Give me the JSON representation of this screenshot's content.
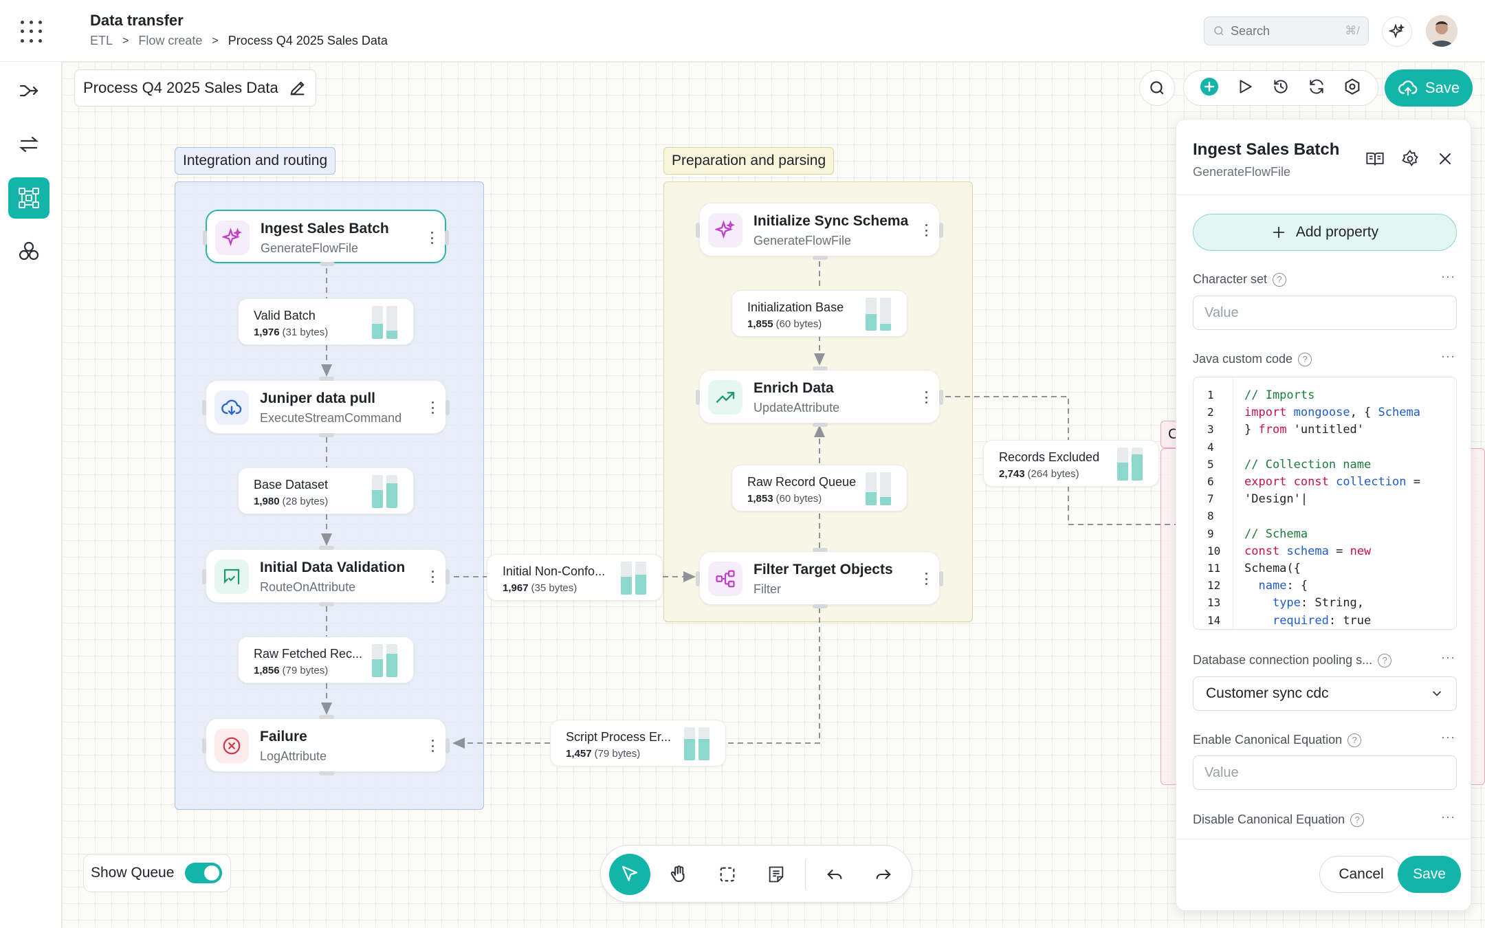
{
  "header": {
    "title": "Data transfer",
    "breadcrumb": [
      "ETL",
      "Flow create",
      "Process Q4 2025 Sales Data"
    ],
    "search_placeholder": "Search",
    "search_shortcut": "⌘/"
  },
  "sidebar": {
    "items": [
      {
        "icon": "route-merge-icon",
        "active": false
      },
      {
        "icon": "transfer-arrows-icon",
        "active": false
      },
      {
        "icon": "flow-builder-icon",
        "active": true
      },
      {
        "icon": "cluster-icon",
        "active": false
      }
    ]
  },
  "canvas": {
    "flow_title": "Process Q4 2025 Sales Data",
    "save_label": "Save",
    "groups": {
      "integration": "Integration and routing",
      "preparation": "Preparation and parsing",
      "third_partial": "C"
    },
    "nodes": {
      "ingest": {
        "title": "Ingest Sales Batch",
        "type": "GenerateFlowFile"
      },
      "juniper": {
        "title": "Juniper data pull",
        "type": "ExecuteStreamCommand"
      },
      "validation": {
        "title": "Initial Data Validation",
        "type": "RouteOnAttribute"
      },
      "failure": {
        "title": "Failure",
        "type": "LogAttribute"
      },
      "init_schema": {
        "title": "Initialize Sync Schema",
        "type": "GenerateFlowFile"
      },
      "enrich": {
        "title": "Enrich Data",
        "type": "UpdateAttribute"
      },
      "filter": {
        "title": "Filter Target Objects",
        "type": "Filter"
      }
    },
    "queues": {
      "valid_batch": {
        "title": "Valid Batch",
        "count": "1,976",
        "size": "(31 bytes)",
        "fill": [
          0.45,
          0.25
        ]
      },
      "base_dataset": {
        "title": "Base Dataset",
        "count": "1,980",
        "size": "(28 bytes)",
        "fill": [
          0.55,
          0.75
        ]
      },
      "raw_fetched": {
        "title": "Raw Fetched Rec...",
        "count": "1,856",
        "size": "(79 bytes)",
        "fill": [
          0.55,
          0.7
        ]
      },
      "initial_nonconf": {
        "title": "Initial Non-Confo...",
        "count": "1,967",
        "size": "(35 bytes)",
        "fill": [
          0.55,
          0.6
        ]
      },
      "init_base": {
        "title": "Initialization Base",
        "count": "1,855",
        "size": "(60 bytes)",
        "fill": [
          0.5,
          0.2
        ]
      },
      "raw_record": {
        "title": "Raw Record Queue",
        "count": "1,853",
        "size": "(60 bytes)",
        "fill": [
          0.4,
          0.25
        ]
      },
      "script_err": {
        "title": "Script Process Er...",
        "count": "1,457",
        "size": "(79 bytes)",
        "fill": [
          0.65,
          0.65
        ]
      },
      "records_excluded": {
        "title": "Records Excluded",
        "count": "2,743",
        "size": "(264 bytes)",
        "fill": [
          0.55,
          0.8
        ]
      }
    }
  },
  "panel": {
    "title": "Ingest Sales Batch",
    "subtitle": "GenerateFlowFile",
    "add_property": "Add property",
    "charset": {
      "label": "Character set",
      "placeholder": "Value"
    },
    "java": {
      "label": "Java custom code",
      "lines": [
        {
          "n": "1",
          "t": "// Imports"
        },
        {
          "n": "2",
          "t": "import mongoose, { Schema"
        },
        {
          "n": "3",
          "t": "} from 'untitled'"
        },
        {
          "n": "4",
          "t": ""
        },
        {
          "n": "5",
          "t": "// Collection name"
        },
        {
          "n": "6",
          "t": "export const collection ="
        },
        {
          "n": "7",
          "t": "'Design'|"
        },
        {
          "n": "8",
          "t": ""
        },
        {
          "n": "9",
          "t": "// Schema"
        },
        {
          "n": "10",
          "t": "const schema = new"
        },
        {
          "n": "11",
          "t": "Schema({"
        },
        {
          "n": "12",
          "t": "  name: {"
        },
        {
          "n": "13",
          "t": "    type: String,"
        },
        {
          "n": "14",
          "t": "    required: true"
        }
      ]
    },
    "db_pool": {
      "label": "Database connection pooling s...",
      "value": "Customer sync cdc"
    },
    "enable_eq": {
      "label": "Enable Canonical Equation",
      "placeholder": "Value"
    },
    "disable_eq": {
      "label": "Disable Canonical Equation"
    },
    "cancel": "Cancel",
    "save": "Save"
  },
  "bottom": {
    "show_queue": "Show Queue",
    "show_queue_on": true,
    "tools": [
      "pointer-icon",
      "hand-icon",
      "marquee-select-icon",
      "note-icon",
      "undo-icon",
      "redo-icon"
    ]
  },
  "colors": {
    "accent": "#12b5a7",
    "queue_fill": "#8cd8cc",
    "group_blue": "#a9c1ec",
    "group_yellow": "#ddd79c",
    "group_pink": "#eea6bb"
  }
}
